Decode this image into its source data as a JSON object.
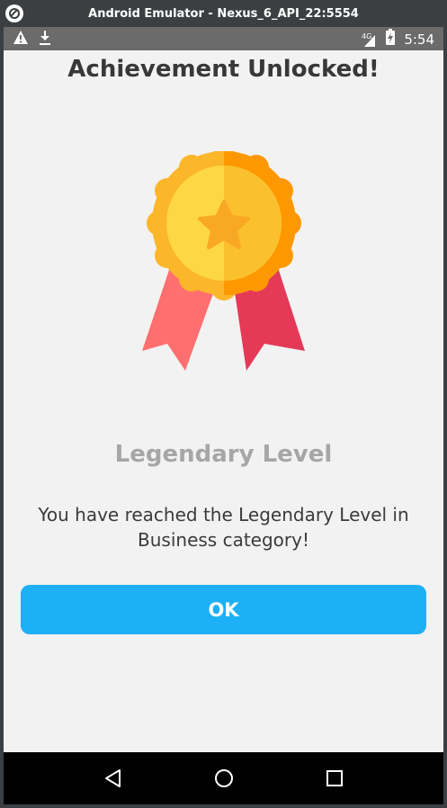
{
  "window": {
    "title": "Android Emulator - Nexus_6_API_22:5554"
  },
  "statusbar": {
    "left_icons": [
      "warning-icon",
      "download-icon"
    ],
    "network": "4G",
    "time": "5:54"
  },
  "dialog": {
    "title": "Achievement Unlocked!",
    "badge_icon": "medal-icon",
    "level_name": "Legendary Level",
    "message": "You have reached the Legendary Level in Business category!",
    "ok_label": "OK"
  },
  "navbar": {
    "buttons": [
      "back-icon",
      "home-icon",
      "recents-icon"
    ]
  },
  "colors": {
    "accent": "#1eb0f5",
    "medal_gold": "#fbc02d",
    "medal_orange": "#ff8f00",
    "ribbon_left": "#ff6f6f",
    "ribbon_right": "#e53958"
  }
}
